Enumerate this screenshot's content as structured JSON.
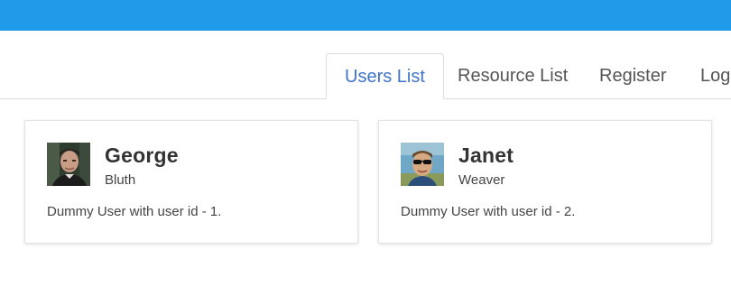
{
  "header": {
    "color": "#209be9"
  },
  "tabs": [
    {
      "label": "Users List",
      "active": true
    },
    {
      "label": "Resource List",
      "active": false
    },
    {
      "label": "Register",
      "active": false
    },
    {
      "label": "Log",
      "active": false
    }
  ],
  "users": [
    {
      "first_name": "George",
      "last_name": "Bluth",
      "description": "Dummy User with user id - 1."
    },
    {
      "first_name": "Janet",
      "last_name": "Weaver",
      "description": "Dummy User with user id - 2."
    }
  ],
  "colors": {
    "active_tab": "#3f74c9",
    "tab_text": "#555555"
  }
}
